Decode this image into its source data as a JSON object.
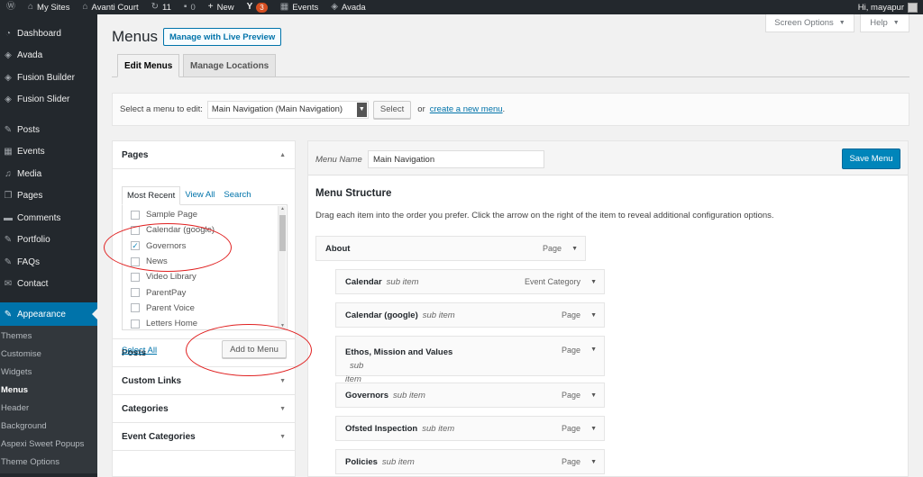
{
  "adminbar": {
    "my_sites": "My Sites",
    "site_name": "Avanti Court",
    "updates_count": "11",
    "comments_count": "0",
    "new_label": "New",
    "yoast_badge": "3",
    "events_label": "Events",
    "avada_label": "Avada",
    "greeting": "Hi, mayapur"
  },
  "sidebar": {
    "items": [
      {
        "label": "Dashboard",
        "icon": "dashboard-icon"
      },
      {
        "label": "Avada",
        "icon": "avada-icon"
      },
      {
        "label": "Fusion Builder",
        "icon": "fusion-builder-icon"
      },
      {
        "label": "Fusion Slider",
        "icon": "fusion-slider-icon"
      },
      {
        "label": "Posts",
        "icon": "pin-icon"
      },
      {
        "label": "Events",
        "icon": "calendar-icon"
      },
      {
        "label": "Media",
        "icon": "media-icon"
      },
      {
        "label": "Pages",
        "icon": "pages-icon"
      },
      {
        "label": "Comments",
        "icon": "comments-icon"
      },
      {
        "label": "Portfolio",
        "icon": "pin-icon"
      },
      {
        "label": "FAQs",
        "icon": "pin-icon"
      },
      {
        "label": "Contact",
        "icon": "mail-icon"
      },
      {
        "label": "Appearance",
        "icon": "paintbrush-icon"
      }
    ],
    "submenu": [
      "Themes",
      "Customise",
      "Widgets",
      "Menus",
      "Header",
      "Background",
      "Aspexi Sweet Popups",
      "Theme Options"
    ]
  },
  "screen_options": "Screen Options",
  "help": "Help",
  "page": {
    "title": "Menus",
    "live_preview": "Manage with Live Preview"
  },
  "tabs": [
    "Edit Menus",
    "Manage Locations"
  ],
  "manage": {
    "label": "Select a menu to edit:",
    "selected_menu": "Main Navigation (Main Navigation)",
    "select_button": "Select",
    "or": "or",
    "create_link": "create a new menu",
    "period": "."
  },
  "accordion": {
    "pages_title": "Pages",
    "subtabs": [
      "Most Recent",
      "View All",
      "Search"
    ],
    "pages": [
      {
        "label": "Sample Page",
        "checked": false
      },
      {
        "label": "Calendar (google)",
        "checked": false
      },
      {
        "label": "Governors",
        "checked": true
      },
      {
        "label": "News",
        "checked": false
      },
      {
        "label": "Video Library",
        "checked": false
      },
      {
        "label": "ParentPay",
        "checked": false
      },
      {
        "label": "Parent Voice",
        "checked": false
      },
      {
        "label": "Letters Home",
        "checked": false
      }
    ],
    "select_all": "Select All",
    "add_to_menu": "Add to Menu",
    "sections": [
      "Posts",
      "Custom Links",
      "Categories",
      "Event Categories"
    ]
  },
  "menu_editor": {
    "name_label": "Menu Name",
    "name_value": "Main Navigation",
    "save_button": "Save Menu",
    "structure_title": "Menu Structure",
    "structure_desc": "Drag each item into the order you prefer. Click the arrow on the right of the item to reveal additional configuration options.",
    "items": [
      {
        "title": "About",
        "sub": "",
        "type": "Page"
      },
      {
        "title": "Calendar",
        "sub": "sub item",
        "type": "Event Category"
      },
      {
        "title": "Calendar (google)",
        "sub": "sub item",
        "type": "Page"
      },
      {
        "title": "Ethos, Mission and Values",
        "sub": "sub",
        "sub2": "item",
        "type": "Page"
      },
      {
        "title": "Governors",
        "sub": "sub item",
        "type": "Page"
      },
      {
        "title": "Ofsted Inspection",
        "sub": "sub item",
        "type": "Page"
      },
      {
        "title": "Policies",
        "sub": "sub item",
        "type": "Page"
      }
    ]
  },
  "colors": {
    "admin_dark": "#23282d",
    "accent_blue": "#0073aa",
    "annotation_red": "#e02020"
  }
}
